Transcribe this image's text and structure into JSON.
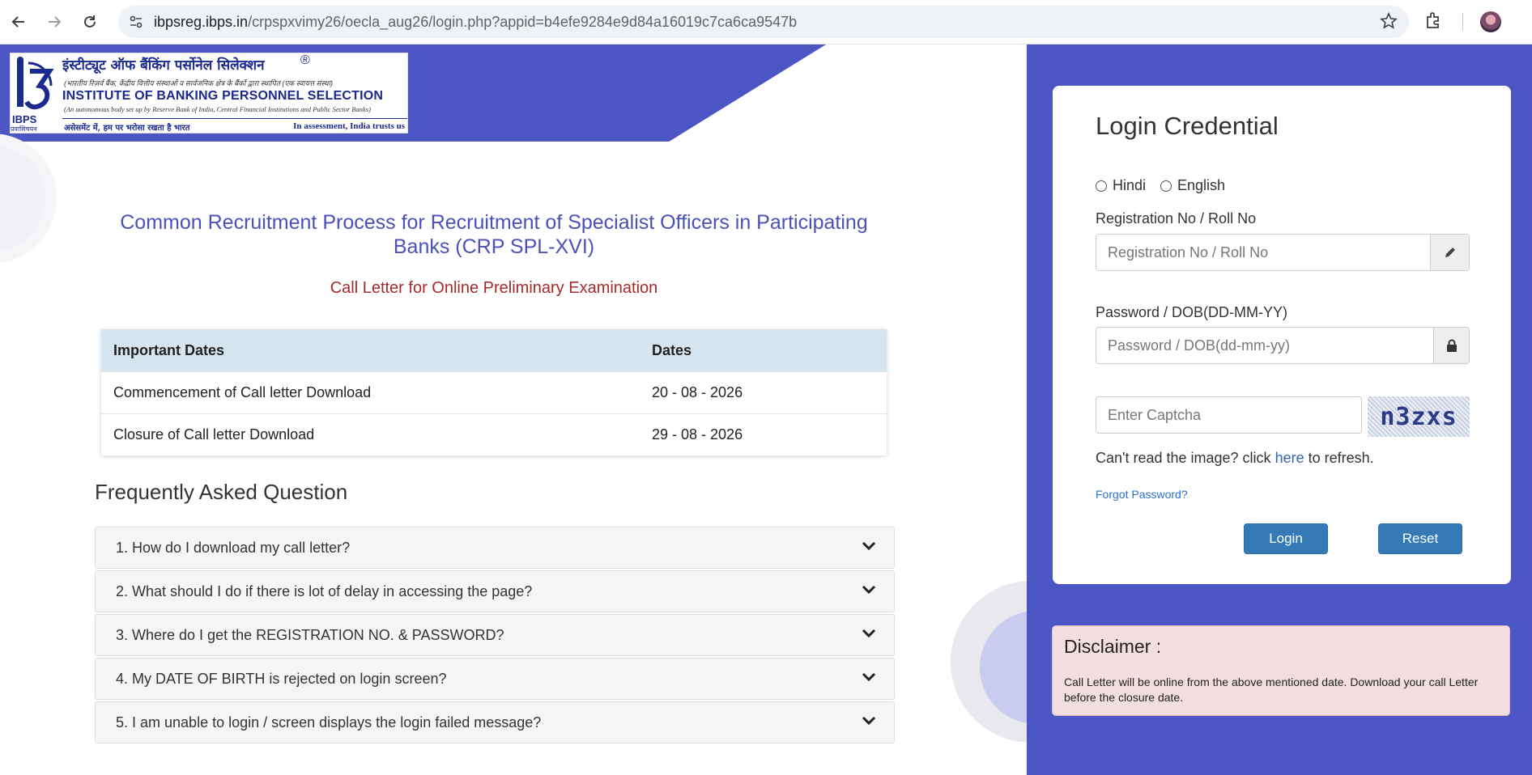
{
  "browser": {
    "url_domain": "ibpsreg.ibps.in",
    "url_path": "/crpspxvimy26/oecla_aug26/login.php?appid=b4efe9284e9d84a16019c7ca6ca9547b"
  },
  "logo": {
    "hindi_name": "इंस्टीट्यूट ऑफ बैंकिंग पर्सोनेल सिलेक्शन",
    "hindi_sub": "(भारतीय रिज़र्व बैंक, केंद्रीय वित्तीय संस्थाओं व सार्वजनिक क्षेत्र के बैंकों द्वारा स्थापित (एक स्वायत्त संस्था)",
    "english_name": "INSTITUTE OF BANKING PERSONNEL SELECTION",
    "english_sub": "(An autonomous body set up by Reserve Bank of India, Central Financial Institutions and Public Sector Banks)",
    "tagline_hindi": "असेसमेंट में, हम पर भरोसा रखता है भारत",
    "tagline_english": "In assessment, India trusts us",
    "abbr": "IBPS",
    "abbr_hindi": "प्रवासिचयन"
  },
  "main": {
    "title": "Common Recruitment Process for Recruitment of Specialist Officers in Participating Banks (CRP SPL-XVI)",
    "subtitle": "Call Letter for Online Preliminary Examination",
    "dates_table": {
      "headers": [
        "Important Dates",
        "Dates"
      ],
      "rows": [
        [
          "Commencement of Call letter Download",
          "20 - 08 - 2026"
        ],
        [
          "Closure of Call letter Download",
          "29 - 08 - 2026"
        ]
      ]
    },
    "faq_title": "Frequently Asked Question",
    "faqs": [
      "1. How do I download my call letter?",
      "2. What should I do if there is lot of delay in accessing the page?",
      "3. Where do I get the REGISTRATION NO. & PASSWORD?",
      "4. My DATE OF BIRTH is rejected on login screen?",
      "5. I am unable to login / screen displays the login failed message?"
    ]
  },
  "login": {
    "title": "Login Credential",
    "lang_hindi": "Hindi",
    "lang_english": "English",
    "reg_label": "Registration No / Roll No",
    "reg_placeholder": "Registration No / Roll No",
    "pwd_label": "Password / DOB(DD-MM-YY)",
    "pwd_placeholder": "Password / DOB(dd-mm-yy)",
    "captcha_placeholder": "Enter Captcha",
    "captcha_text": "n3zxs",
    "refresh_prefix": "Can't read the image? click",
    "refresh_link": "here",
    "refresh_suffix": "to refresh.",
    "forgot": "Forgot Password?",
    "login_btn": "Login",
    "reset_btn": "Reset"
  },
  "disclaimer": {
    "title": "Disclaimer :",
    "text": "Call Letter will be online from the above mentioned date. Download your call Letter before the closure date."
  },
  "colors": {
    "brand": "#4c55c4",
    "title_blue": "#4a51b8",
    "subtitle_red": "#a52a2a",
    "button": "#337ab7",
    "disclaimer_bg": "#f2dede"
  }
}
